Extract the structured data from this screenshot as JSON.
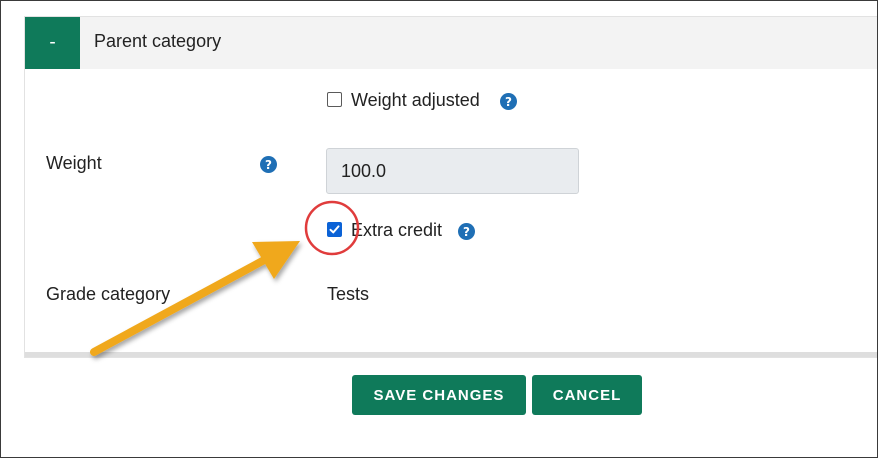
{
  "section": {
    "collapse_label": "-",
    "title": "Parent category"
  },
  "weight_adjusted": {
    "label": "Weight adjusted",
    "checked": false
  },
  "weight": {
    "label": "Weight",
    "value": "100.0"
  },
  "extra_credit": {
    "label": "Extra credit",
    "checked": true
  },
  "grade_category": {
    "label": "Grade category",
    "value": "Tests"
  },
  "buttons": {
    "save": "SAVE CHANGES",
    "cancel": "CANCEL"
  },
  "help_glyph": "?",
  "colors": {
    "primary": "#0f7a5a",
    "help": "#1f6fb5",
    "checkbox_checked": "#0b62d6",
    "annotation_arrow": "#f0a81a",
    "annotation_circle": "#e03c3c"
  }
}
